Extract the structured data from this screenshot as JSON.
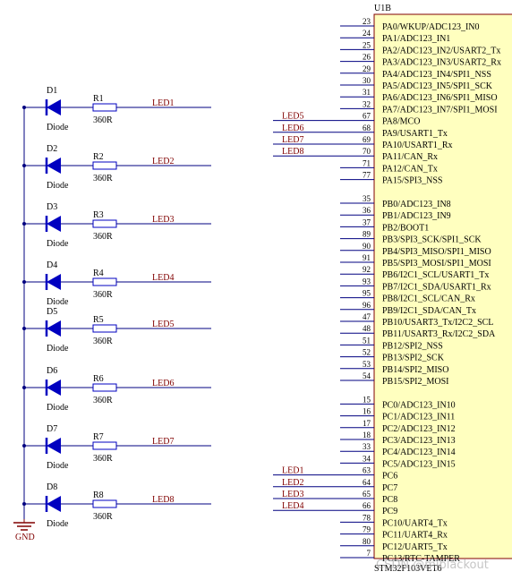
{
  "colors": {
    "background": "#ffffff",
    "wire": "#000080",
    "chip_fill": "#ffffbf",
    "chip_border": "#800000",
    "component": "#0000c0",
    "label": "#800000",
    "text": "#000000",
    "ground": "#800000"
  },
  "chip": {
    "designator": "U1B",
    "part": "STM32F103VET6",
    "pins": [
      {
        "num": "23",
        "name": "PA0/WKUP/ADC123_IN0",
        "net": ""
      },
      {
        "num": "24",
        "name": "PA1/ADC123_IN1",
        "net": ""
      },
      {
        "num": "25",
        "name": "PA2/ADC123_IN2/USART2_Tx",
        "net": ""
      },
      {
        "num": "26",
        "name": "PA3/ADC123_IN3/USART2_Rx",
        "net": ""
      },
      {
        "num": "29",
        "name": "PA4/ADC123_IN4/SPI1_NSS",
        "net": ""
      },
      {
        "num": "30",
        "name": "PA5/ADC123_IN5/SPI1_SCK",
        "net": ""
      },
      {
        "num": "31",
        "name": "PA6/ADC123_IN6/SPI1_MISO",
        "net": ""
      },
      {
        "num": "32",
        "name": "PA7/ADC123_IN7/SPI1_MOSI",
        "net": ""
      },
      {
        "num": "67",
        "name": "PA8/MCO",
        "net": "LED5"
      },
      {
        "num": "68",
        "name": "PA9/USART1_Tx",
        "net": "LED6"
      },
      {
        "num": "69",
        "name": "PA10/USART1_Rx",
        "net": "LED7"
      },
      {
        "num": "70",
        "name": "PA11/CAN_Rx",
        "net": "LED8"
      },
      {
        "num": "71",
        "name": "PA12/CAN_Tx",
        "net": ""
      },
      {
        "num": "77",
        "name": "PA15/SPI3_NSS",
        "net": ""
      },
      {
        "num": "35",
        "name": "PB0/ADC123_IN8",
        "net": ""
      },
      {
        "num": "36",
        "name": "PB1/ADC123_IN9",
        "net": ""
      },
      {
        "num": "37",
        "name": "PB2/BOOT1",
        "net": ""
      },
      {
        "num": "89",
        "name": "PB3/SPI3_SCK/SPI1_SCK",
        "net": ""
      },
      {
        "num": "90",
        "name": "PB4/SPI3_MISO/SPI1_MISO",
        "net": ""
      },
      {
        "num": "91",
        "name": "PB5/SPI3_MOSI/SPI1_MOSI",
        "net": ""
      },
      {
        "num": "92",
        "name": "PB6/I2C1_SCL/USART1_Tx",
        "net": ""
      },
      {
        "num": "93",
        "name": "PB7/I2C1_SDA/USART1_Rx",
        "net": ""
      },
      {
        "num": "95",
        "name": "PB8/I2C1_SCL/CAN_Rx",
        "net": ""
      },
      {
        "num": "96",
        "name": "PB9/I2C1_SDA/CAN_Tx",
        "net": ""
      },
      {
        "num": "47",
        "name": "PB10/USART3_Tx/I2C2_SCL",
        "net": ""
      },
      {
        "num": "48",
        "name": "PB11/USART3_Rx/I2C2_SDA",
        "net": ""
      },
      {
        "num": "51",
        "name": "PB12/SPI2_NSS",
        "net": ""
      },
      {
        "num": "52",
        "name": "PB13/SPI2_SCK",
        "net": ""
      },
      {
        "num": "53",
        "name": "PB14/SPI2_MISO",
        "net": ""
      },
      {
        "num": "54",
        "name": "PB15/SPI2_MOSI",
        "net": ""
      },
      {
        "num": "15",
        "name": "PC0/ADC123_IN10",
        "net": ""
      },
      {
        "num": "16",
        "name": "PC1/ADC123_IN11",
        "net": ""
      },
      {
        "num": "17",
        "name": "PC2/ADC123_IN12",
        "net": ""
      },
      {
        "num": "18",
        "name": "PC3/ADC123_IN13",
        "net": ""
      },
      {
        "num": "33",
        "name": "PC4/ADC123_IN14",
        "net": ""
      },
      {
        "num": "34",
        "name": "PC5/ADC123_IN15",
        "net": ""
      },
      {
        "num": "63",
        "name": "PC6",
        "net": "LED1"
      },
      {
        "num": "64",
        "name": "PC7",
        "net": "LED2"
      },
      {
        "num": "65",
        "name": "PC8",
        "net": "LED3"
      },
      {
        "num": "66",
        "name": "PC9",
        "net": "LED4"
      },
      {
        "num": "78",
        "name": "PC10/UART4_Tx",
        "net": ""
      },
      {
        "num": "79",
        "name": "PC11/UART4_Rx",
        "net": ""
      },
      {
        "num": "80",
        "name": "PC12/UART5_Tx",
        "net": ""
      },
      {
        "num": "7",
        "name": "PC13/RTC-TAMPER",
        "net": ""
      }
    ]
  },
  "leds": [
    {
      "diode": "D1",
      "diode_type": "Diode",
      "resistor": "R1",
      "value": "360R",
      "net": "LED1"
    },
    {
      "diode": "D2",
      "diode_type": "Diode",
      "resistor": "R2",
      "value": "360R",
      "net": "LED2"
    },
    {
      "diode": "D3",
      "diode_type": "Diode",
      "resistor": "R3",
      "value": "360R",
      "net": "LED3"
    },
    {
      "diode": "D4",
      "diode_type": "Diode",
      "resistor": "R4",
      "value": "360R",
      "net": "LED4"
    },
    {
      "diode": "D5",
      "diode_type": "Diode",
      "resistor": "R5",
      "value": "360R",
      "net": "LED5"
    },
    {
      "diode": "D6",
      "diode_type": "Diode",
      "resistor": "R6",
      "value": "360R",
      "net": "LED6"
    },
    {
      "diode": "D7",
      "diode_type": "Diode",
      "resistor": "R7",
      "value": "360R",
      "net": "LED7"
    },
    {
      "diode": "D8",
      "diode_type": "Diode",
      "resistor": "R8",
      "value": "360R",
      "net": "LED8"
    }
  ],
  "ground": {
    "label": "GND"
  },
  "watermark": "CSDN @mjblackout"
}
